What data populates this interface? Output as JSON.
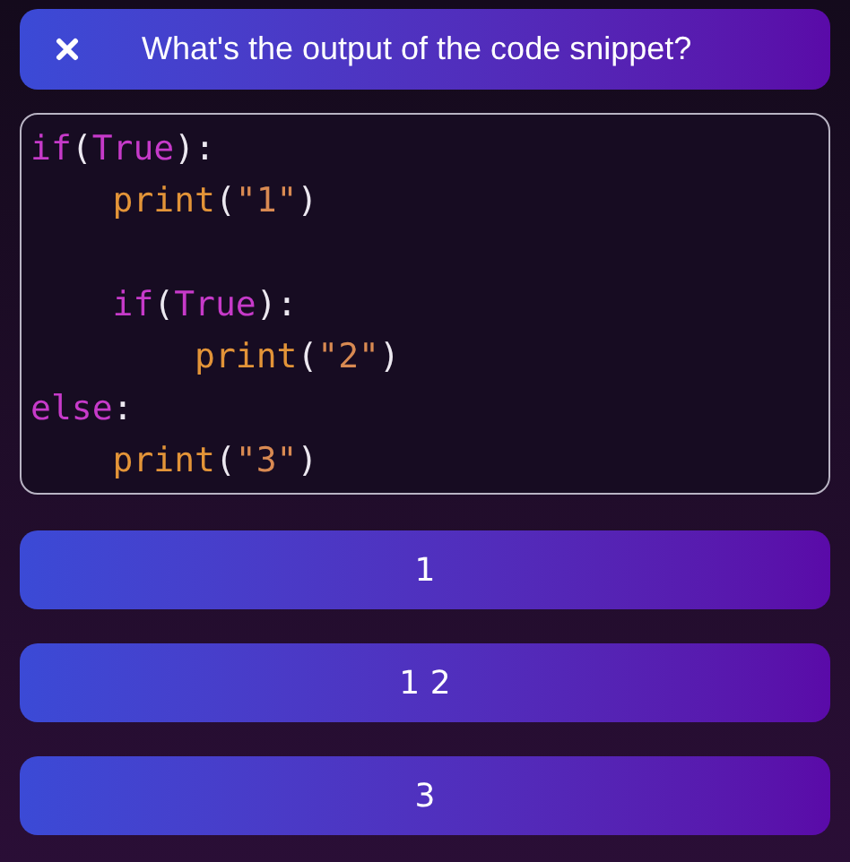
{
  "header": {
    "title": "What's the output of the code snippet?"
  },
  "code": {
    "lines": [
      {
        "kind": "code",
        "tokens": [
          {
            "kind": "keyword",
            "text": "if"
          },
          {
            "kind": "plain",
            "text": "("
          },
          {
            "kind": "keyword",
            "text": "True"
          },
          {
            "kind": "plain",
            "text": "):"
          }
        ],
        "children": [
          {
            "kind": "code",
            "tokens": [
              {
                "kind": "function",
                "text": "print"
              },
              {
                "kind": "plain",
                "text": "("
              },
              {
                "kind": "string",
                "text": "\"1\""
              },
              {
                "kind": "plain",
                "text": ")"
              }
            ]
          },
          {
            "kind": "blank"
          },
          {
            "kind": "code",
            "tokens": [
              {
                "kind": "keyword",
                "text": "if"
              },
              {
                "kind": "plain",
                "text": "("
              },
              {
                "kind": "keyword",
                "text": "True"
              },
              {
                "kind": "plain",
                "text": "):"
              }
            ],
            "children": [
              {
                "kind": "code",
                "tokens": [
                  {
                    "kind": "function",
                    "text": "print"
                  },
                  {
                    "kind": "plain",
                    "text": "("
                  },
                  {
                    "kind": "string",
                    "text": "\"2\""
                  },
                  {
                    "kind": "plain",
                    "text": ")"
                  }
                ]
              }
            ]
          }
        ]
      },
      {
        "kind": "code",
        "tokens": [
          {
            "kind": "keyword",
            "text": "else"
          },
          {
            "kind": "plain",
            "text": ":"
          }
        ],
        "children": [
          {
            "kind": "code",
            "tokens": [
              {
                "kind": "function",
                "text": "print"
              },
              {
                "kind": "plain",
                "text": "("
              },
              {
                "kind": "string",
                "text": "\"3\""
              },
              {
                "kind": "plain",
                "text": ")"
              }
            ]
          }
        ]
      }
    ]
  },
  "answers": [
    {
      "label": "1"
    },
    {
      "label": "1 2"
    },
    {
      "label": "3"
    }
  ]
}
